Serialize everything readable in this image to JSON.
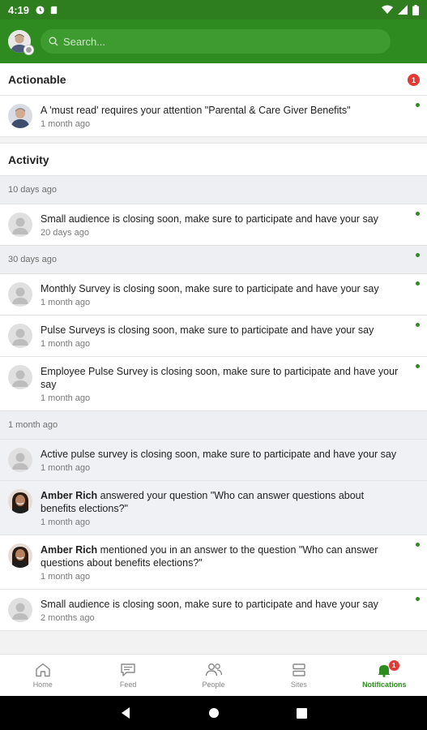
{
  "status_bar": {
    "time": "4:19"
  },
  "search": {
    "placeholder": "Search..."
  },
  "sections": {
    "actionable": {
      "title": "Actionable",
      "count": "1"
    },
    "activity": {
      "title": "Activity"
    }
  },
  "actionable_items": [
    {
      "text": "A 'must read' requires your attention \"Parental & Care Giver Benefits\"",
      "time": "1 month ago"
    }
  ],
  "groups": [
    {
      "label": "10 days ago",
      "items": [
        {
          "text": "Small audience is closing soon, make sure to participate and have your say",
          "time": "20 days ago"
        }
      ]
    },
    {
      "label": "30 days ago",
      "items": [
        {
          "text": "Monthly Survey is closing soon, make sure to participate and have your say",
          "time": "1 month ago"
        },
        {
          "text": "Pulse Surveys is closing soon, make sure to participate and have your say",
          "time": "1 month ago"
        },
        {
          "text": "Employee Pulse Survey is closing soon, make sure to participate and have your say",
          "time": "1 month ago"
        }
      ]
    },
    {
      "label": "1 month ago",
      "items": [
        {
          "text": "Active pulse survey is closing soon, make sure to participate and have your say",
          "time": "1 month ago"
        },
        {
          "name": "Amber Rich",
          "text": " answered your question \"Who can answer questions about benefits elections?\"",
          "time": "1 month ago"
        },
        {
          "name": "Amber Rich",
          "text": " mentioned you in an answer to the question \"Who can answer questions about benefits elections?\"",
          "time": "1 month ago"
        },
        {
          "text": "Small audience is closing soon, make sure to participate and have your say",
          "time": "2 months ago"
        }
      ]
    }
  ],
  "bottom_nav": {
    "home": "Home",
    "feed": "Feed",
    "people": "People",
    "sites": "Sites",
    "notifications": "Notifications",
    "notifications_badge": "1"
  },
  "colors": {
    "brand_green": "#2e8b1f",
    "badge_red": "#e53935"
  }
}
